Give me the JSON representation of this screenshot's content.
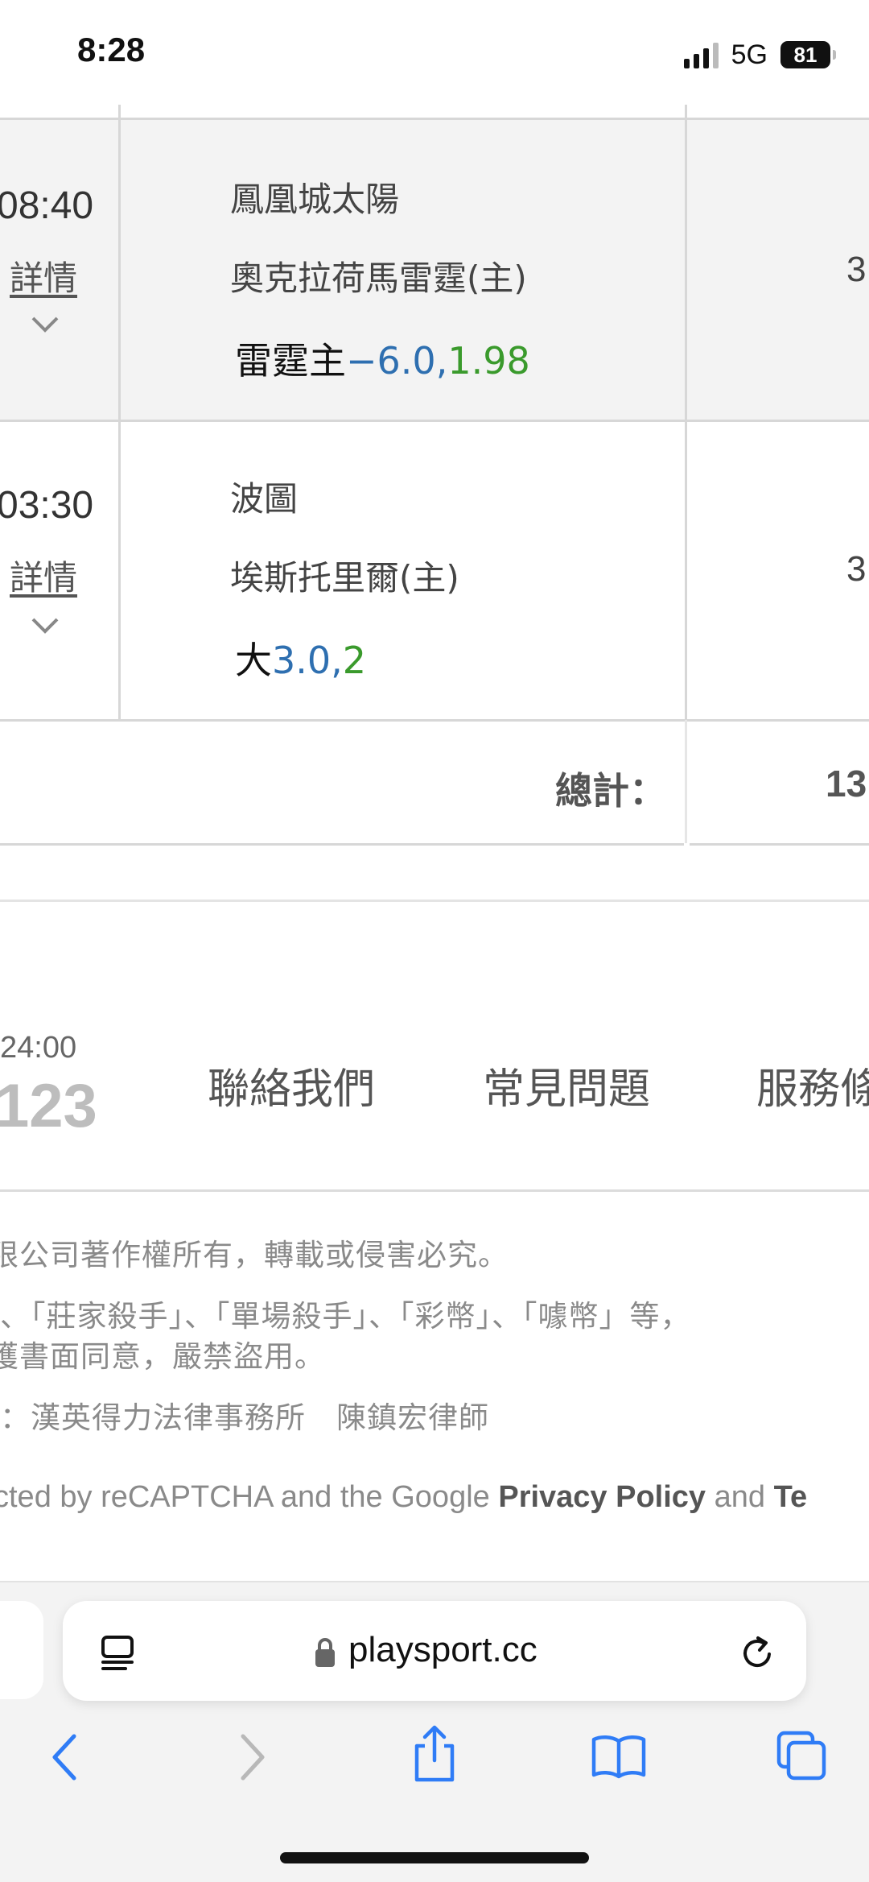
{
  "status_bar": {
    "time": "8:28",
    "network": "5G",
    "battery": "81"
  },
  "matches": [
    {
      "time": "08:40",
      "detail_label": "詳情",
      "team_away": "鳳凰城太陽",
      "team_home": "奧克拉荷馬雷霆(主)",
      "pick_prefix": "雷霆主",
      "pick_line": "−6.0",
      "pick_sep": ",",
      "pick_odds": "1.98",
      "right_value": "3"
    },
    {
      "time": "03:30",
      "detail_label": "詳情",
      "team_away": "波圖",
      "team_home": "埃斯托里爾(主)",
      "pick_prefix": "大",
      "pick_line": "3.0",
      "pick_sep": ",",
      "pick_odds": "2",
      "right_value": "3"
    }
  ],
  "total": {
    "label": "總計：",
    "value": "13"
  },
  "footer": {
    "service_hours": "24:00",
    "service_phone": "123",
    "links": [
      "聯絡我們",
      "常見問題",
      "服務條"
    ],
    "legal_lines": [
      "限公司著作權所有，轉載或侵害必究。",
      "、「莊家殺手」、「單場殺手」、「彩幣」、「噱幣」等，",
      "獲書面同意，嚴禁盜用。",
      "：漢英得力法律事務所　陳鎮宏律師"
    ],
    "recaptcha": {
      "text1": "cted by reCAPTCHA and the Google ",
      "privacy": "Privacy Policy",
      "and": " and ",
      "terms": "Te"
    }
  },
  "browser": {
    "url": "playsport.cc",
    "icons": [
      "tab-layout-icon",
      "lock-icon",
      "reload-icon",
      "back-icon",
      "forward-icon",
      "share-icon",
      "bookmarks-icon",
      "tabs-icon"
    ]
  }
}
